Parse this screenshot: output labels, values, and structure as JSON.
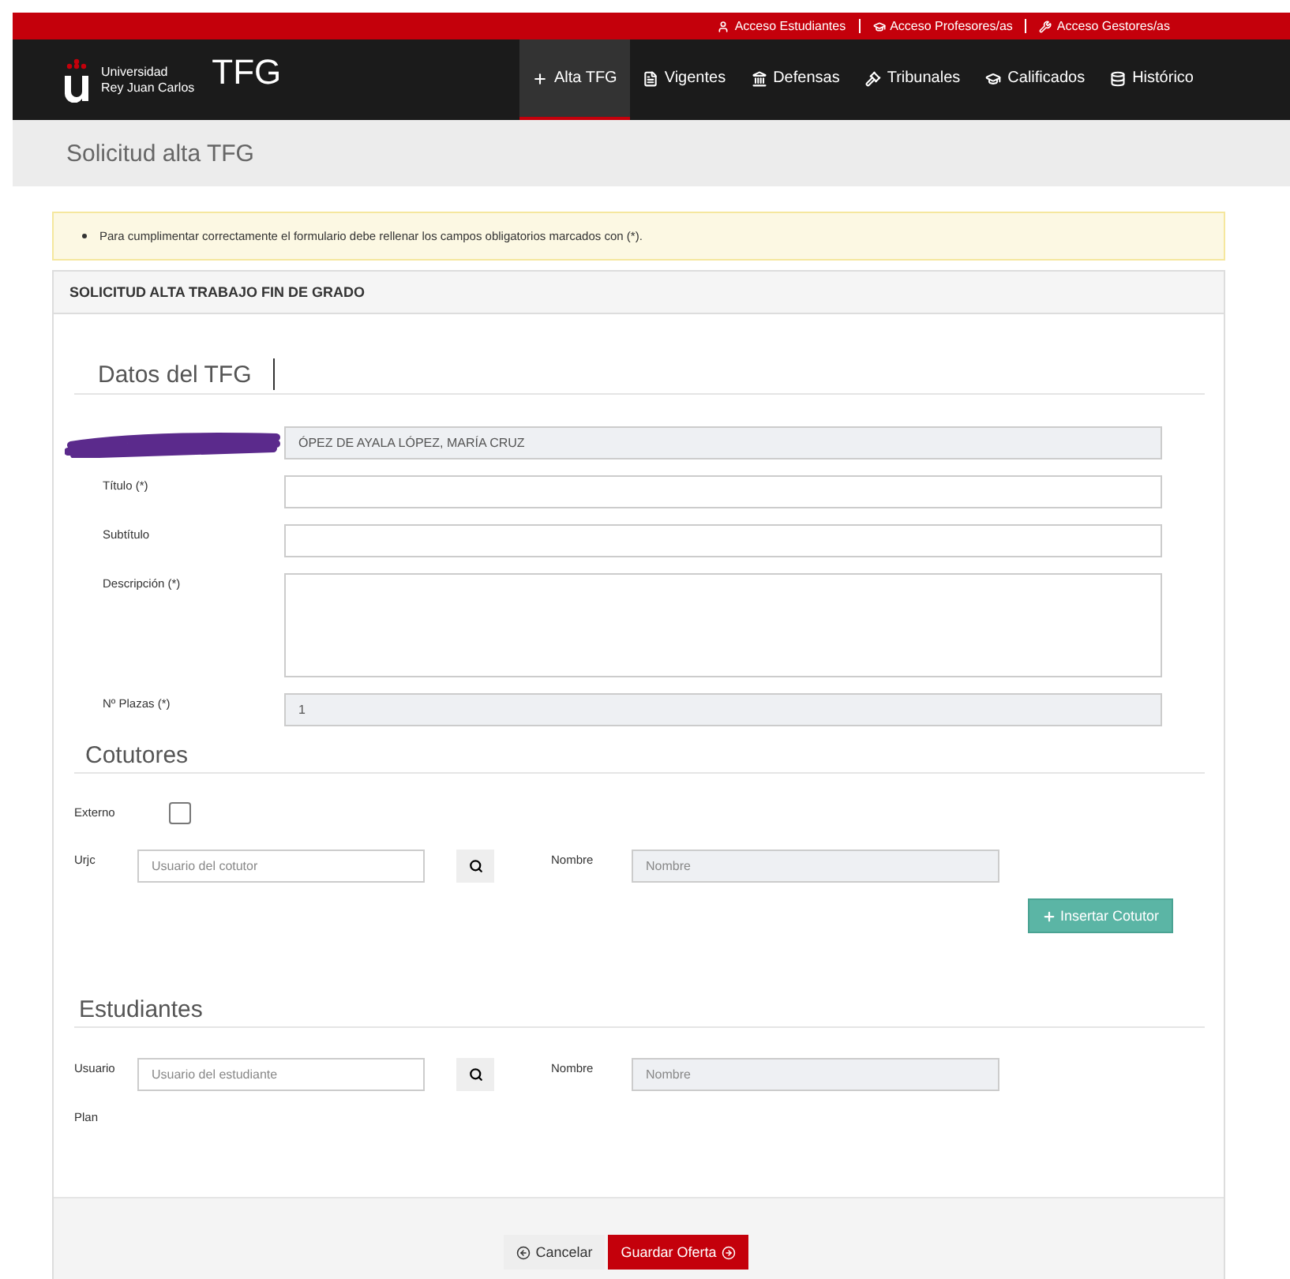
{
  "top_links": [
    {
      "label": "Acceso Estudiantes"
    },
    {
      "label": "Acceso Profesores/as"
    },
    {
      "label": "Acceso Gestores/as"
    }
  ],
  "brand": {
    "line1": "Universidad",
    "line2": "Rey Juan Carlos",
    "app": "TFG"
  },
  "nav": [
    {
      "label": "Alta TFG",
      "selected": true
    },
    {
      "label": "Vigentes",
      "selected": false
    },
    {
      "label": "Defensas",
      "selected": false
    },
    {
      "label": "Tribunales",
      "selected": false
    },
    {
      "label": "Calificados",
      "selected": false
    },
    {
      "label": "Histórico",
      "selected": false
    }
  ],
  "page_title": "Solicitud alta TFG",
  "alert": "Para cumplimentar correctamente el formulario debe rellenar los campos obligatorios marcados con (*).",
  "panel_title": "SOLICITUD ALTA TRABAJO FIN DE GRADO",
  "datos": {
    "heading": "Datos del TFG",
    "fields": [
      {
        "kind": "redacted",
        "value": "ÓPEZ DE AYALA LÓPEZ, MARÍA CRUZ"
      },
      {
        "kind": "text",
        "label": "Título (*)"
      },
      {
        "kind": "text",
        "label": "Subtítulo"
      },
      {
        "kind": "textarea",
        "label": "Descripción (*)"
      },
      {
        "kind": "readonly",
        "label": "Nº Plazas (*)",
        "value": "1"
      }
    ]
  },
  "cotutores": {
    "heading": "Cotutores",
    "externo": {
      "label": "Externo",
      "checked": false
    },
    "user": {
      "label": "Urjc",
      "placeholder": "Usuario del cotutor"
    },
    "name": {
      "label": "Nombre",
      "placeholder": "Nombre"
    },
    "insert_button": "Insertar Cotutor"
  },
  "estudiantes": {
    "heading": "Estudiantes",
    "user": {
      "label": "Usuario",
      "placeholder": "Usuario del estudiante"
    },
    "name": {
      "label": "Nombre",
      "placeholder": "Nombre"
    },
    "plan_label": "Plan"
  },
  "footer": {
    "cancel": "Cancelar",
    "save": "Guardar Oferta"
  }
}
